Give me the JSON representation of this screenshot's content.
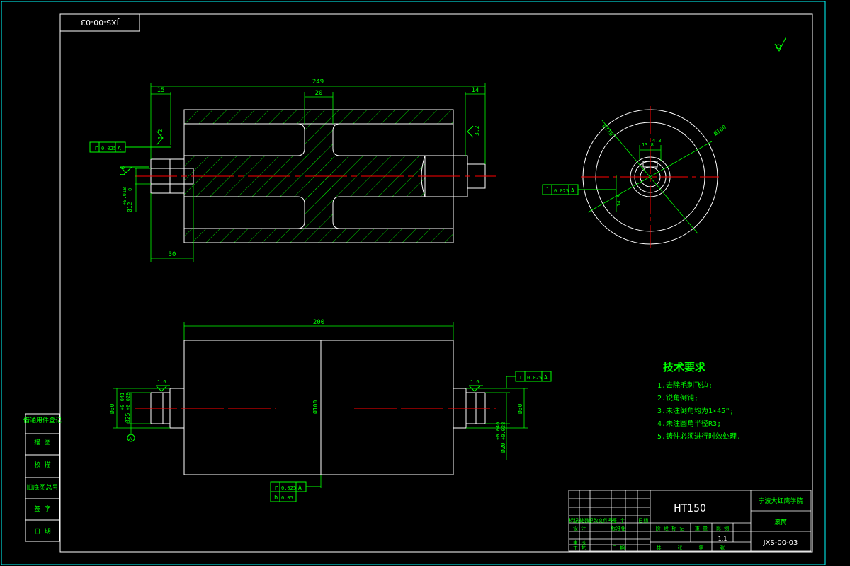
{
  "sheet": {
    "drawing_number_topleft": "JXS-00-03",
    "colors": {
      "background": "#000000",
      "outline": "#ffffff",
      "dimension": "#00ff00",
      "centerline": "#ff0000",
      "frame": "#00ffff",
      "hatch": "#00ff00"
    }
  },
  "front_view": {
    "overall_length": "249",
    "left_shoulder": "15",
    "web_width": "20",
    "right_shoulder": "14",
    "left_boss_length": "30",
    "left_roughness": "3.2",
    "right_roughness": "3.2",
    "left_bore_roughness": "1.6",
    "left_tolerance_symbol": "r",
    "left_tolerance_value": "0.025",
    "left_tolerance_datum": "A",
    "bore_dim": "Ø12",
    "bore_upper": "+0.018",
    "bore_lower": "0"
  },
  "end_view": {
    "outer_dia": "Ø160",
    "middle_dia": "Ø110",
    "key_width": "13.8",
    "key_depth": "4.3",
    "keyway_dim": "14.8",
    "tolerance_symbol": "l",
    "tolerance_value": "0.025",
    "tolerance_datum": "A"
  },
  "lower_view": {
    "length": "200",
    "body_dia": "Ø100",
    "left_shaft_dia": "Ø30",
    "left_shaft_fit": "Ø25",
    "left_fit_upper": "+0.041",
    "left_fit_lower": "+0.028",
    "left_roughness": "1.6",
    "right_roughness": "1.6",
    "right_shaft_dia": "Ø30",
    "right_fit": "Ø20",
    "right_fit_upper": "+0.040",
    "right_fit_lower": "+0.028",
    "right_tolerance_symbol": "r",
    "right_tolerance_value": "0.025",
    "right_tolerance_datum": "A",
    "datum_label": "A",
    "bottom_tol1_symbol": "r",
    "bottom_tol1_value": "0.025",
    "bottom_tol1_datum": "A",
    "bottom_tol2_symbol": "h",
    "bottom_tol2_value": "0.05"
  },
  "tech_requirements": {
    "title": "技术要求",
    "items": [
      "1.去除毛刺飞边;",
      "2.锐角倒钝;",
      "3.未注倒角均为1×45°;",
      "4.未注圆角半径R3;",
      "5.铸件必须进行时效处理."
    ]
  },
  "left_margin_labels": [
    "借通用件登记",
    "描 图",
    "校 描",
    "旧底图总号",
    "签 字",
    "日 期"
  ],
  "title_block": {
    "material": "HT150",
    "school": "宁波大红鹰学院",
    "part_name": "滚筒",
    "drawing_number": "JXS-00-03",
    "scale": "1:1",
    "row_labels": [
      "标记",
      "处数",
      "更改文件号",
      "签 字",
      "日期"
    ],
    "row2_labels": [
      "设 计",
      "标准化"
    ],
    "row3_labels": [
      "审 核"
    ],
    "row4_labels": [
      "工 艺",
      "日 期"
    ],
    "stage_labels": [
      "阶 段 标 记",
      "重 量",
      "比 例"
    ],
    "sheet_labels": [
      "共",
      "张",
      "第",
      "张"
    ]
  }
}
